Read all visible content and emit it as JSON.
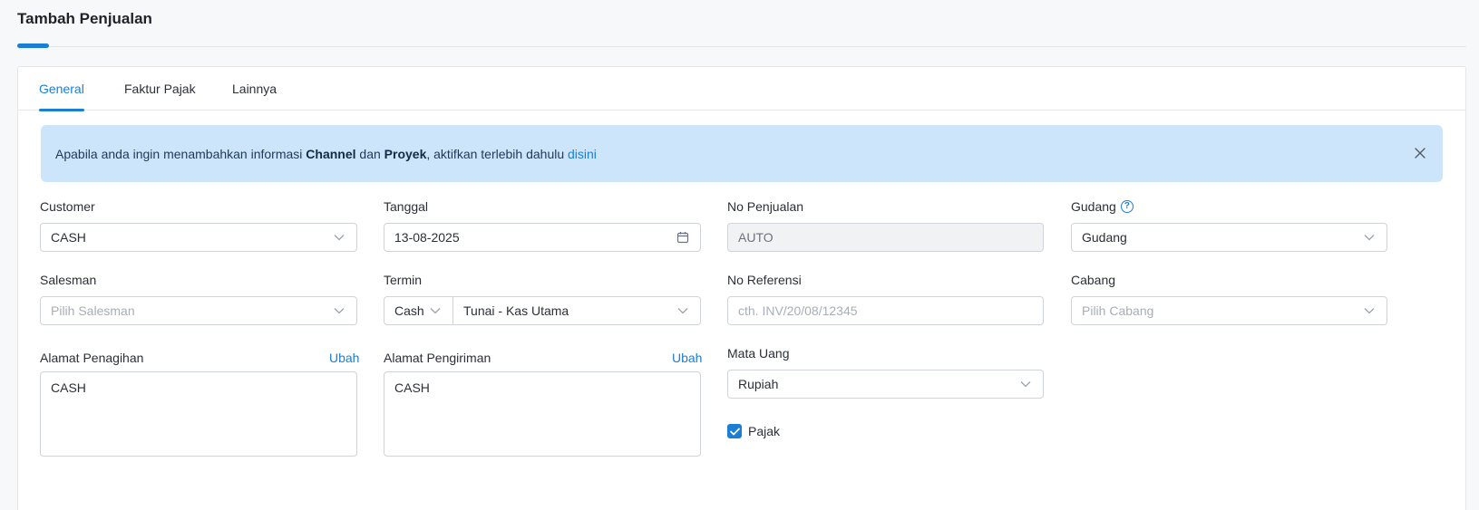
{
  "page": {
    "title": "Tambah Penjualan"
  },
  "tabs": [
    {
      "label": "General",
      "active": true
    },
    {
      "label": "Faktur Pajak",
      "active": false
    },
    {
      "label": "Lainnya",
      "active": false
    }
  ],
  "banner": {
    "text_1": "Apabila anda ingin menambahkan informasi ",
    "bold_1": "Channel",
    "text_2": " dan ",
    "bold_2": "Proyek",
    "text_3": ", aktifkan terlebih dahulu ",
    "link": "disini",
    "close_icon": "close-icon"
  },
  "form": {
    "customer": {
      "label": "Customer",
      "value": "CASH"
    },
    "tanggal": {
      "label": "Tanggal",
      "value": "13-08-2025"
    },
    "no_penjualan": {
      "label": "No Penjualan",
      "value": "AUTO"
    },
    "gudang": {
      "label": "Gudang",
      "value": "Gudang",
      "help_icon": "?"
    },
    "salesman": {
      "label": "Salesman",
      "placeholder": "Pilih Salesman"
    },
    "termin": {
      "label": "Termin",
      "type_value": "Cash",
      "account_value": "Tunai - Kas Utama"
    },
    "no_referensi": {
      "label": "No Referensi",
      "placeholder": "cth. INV/20/08/12345"
    },
    "cabang": {
      "label": "Cabang",
      "placeholder": "Pilih Cabang"
    },
    "alamat_penagihan": {
      "label": "Alamat Penagihan",
      "edit_label": "Ubah",
      "value": "CASH"
    },
    "alamat_pengiriman": {
      "label": "Alamat Pengiriman",
      "edit_label": "Ubah",
      "value": "CASH"
    },
    "mata_uang": {
      "label": "Mata Uang",
      "value": "Rupiah"
    },
    "pajak": {
      "label": "Pajak",
      "checked": true
    }
  },
  "colors": {
    "primary": "#1a7fd4",
    "banner_bg": "#cde5fb",
    "border": "#cfd4da"
  }
}
